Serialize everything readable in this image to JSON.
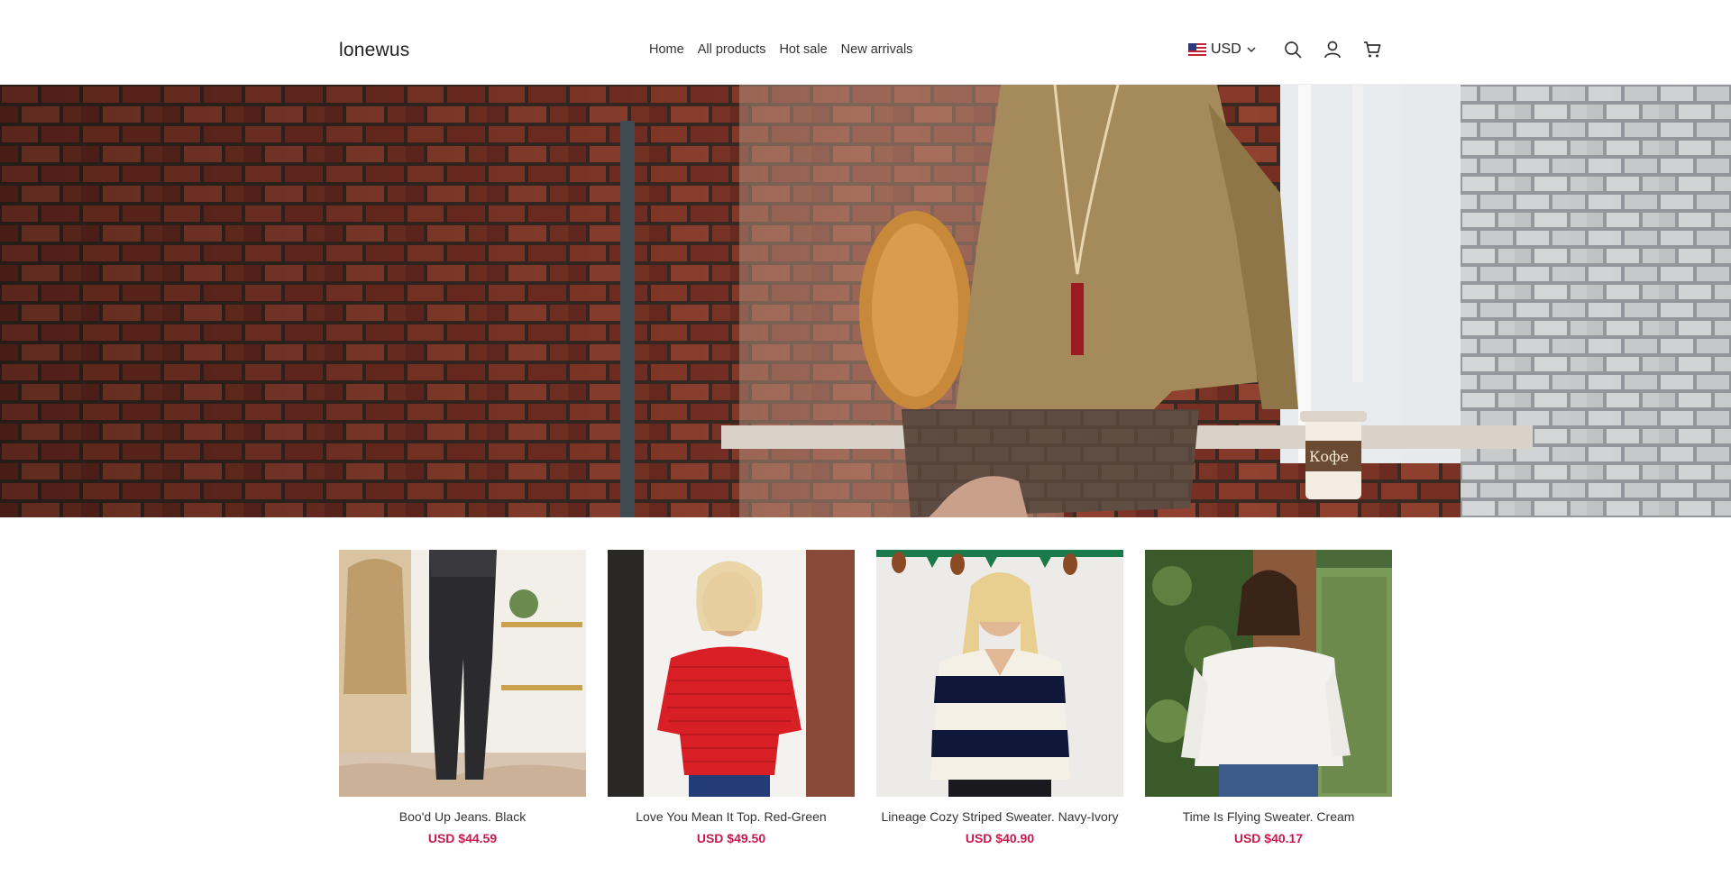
{
  "header": {
    "logo": "lonewus",
    "nav": [
      "Home",
      "All products",
      "Hot sale",
      "New arrivals"
    ],
    "currency": "USD",
    "icons": [
      "us-flag-icon",
      "chevron-down-icon",
      "search-icon",
      "user-icon",
      "cart-icon"
    ]
  },
  "hero": {
    "image": "woman in tan sweater sitting by brick wall window with coffee cup"
  },
  "products": [
    {
      "title": "Boo'd Up Jeans. Black",
      "price": "USD $44.59"
    },
    {
      "title": "Love You Mean It Top. Red-Green",
      "price": "USD $49.50"
    },
    {
      "title": "Lineage Cozy Striped Sweater. Navy-Ivory",
      "price": "USD $40.90"
    },
    {
      "title": "Time Is Flying Sweater. Cream",
      "price": "USD $40.17"
    }
  ],
  "colors": {
    "price": "#c8194c",
    "text": "#333333"
  }
}
